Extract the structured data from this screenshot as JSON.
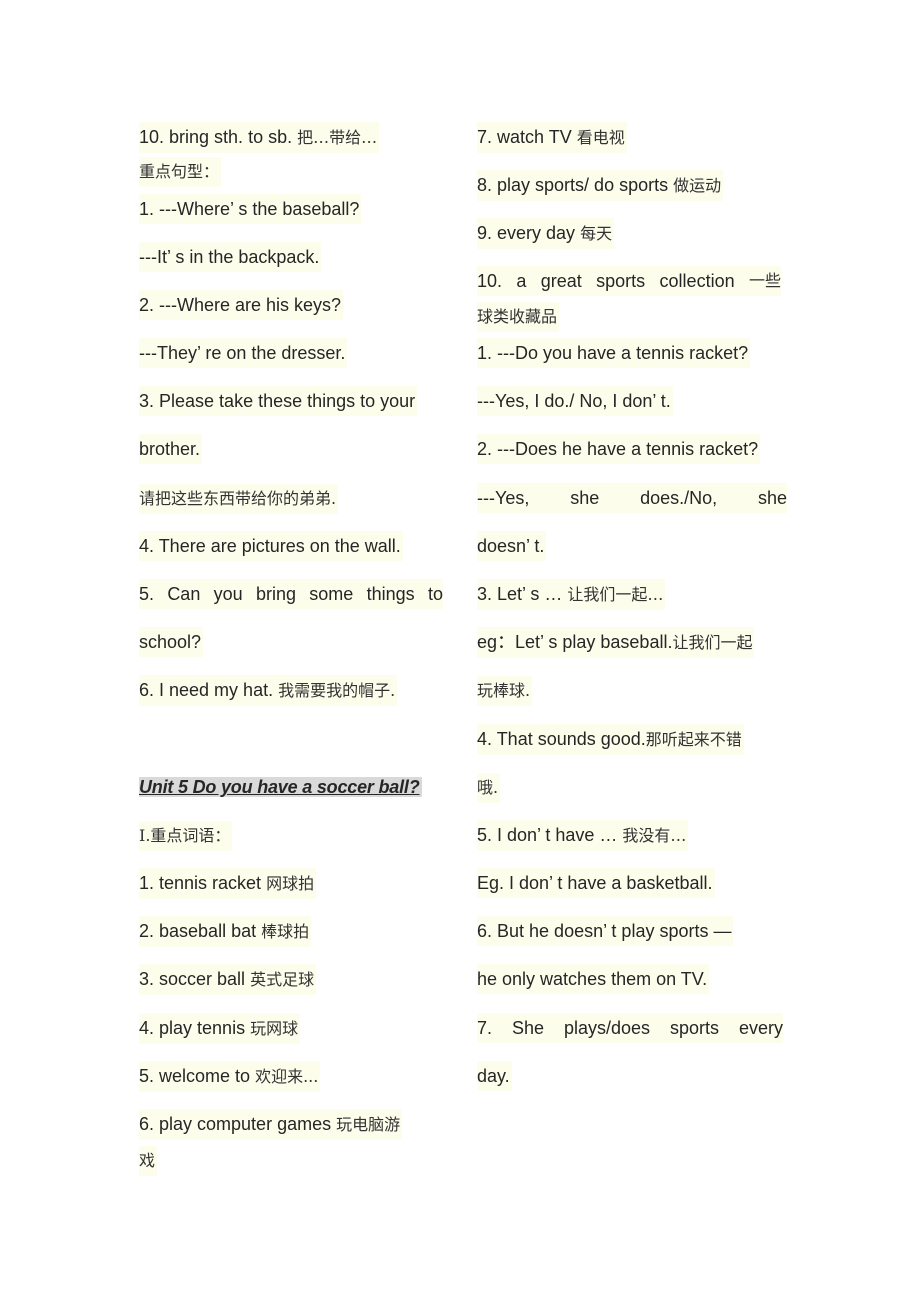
{
  "left_column": {
    "lines": [
      {
        "en": "10. bring sth. to sb. ",
        "zh": "把…带给…"
      },
      {
        "en": "",
        "zh": "重点句型："
      },
      {
        "en": "1. ---Where’ s the baseball?",
        "zh": ""
      },
      {
        "en": "---It’ s in the backpack.",
        "zh": ""
      },
      {
        "en": "2. ---Where are his keys?",
        "zh": ""
      },
      {
        "en": "---They’ re on the dresser.",
        "zh": ""
      },
      {
        "en": "3. Please take these things to your",
        "zh": ""
      },
      {
        "en": "brother.",
        "zh": ""
      },
      {
        "en": "",
        "zh": "请把这些东西带给你的弟弟."
      },
      {
        "en": "4. There are pictures on the wall.",
        "zh": ""
      },
      {
        "en": "5. Can you bring some things to",
        "zh": ""
      },
      {
        "en": "school?",
        "zh": ""
      },
      {
        "en": "6. I need my hat. ",
        "zh": "我需要我的帽子."
      }
    ],
    "unit_title": "Unit 5 Do you have a soccer ball?",
    "section_heading": "Ⅰ.重点词语：",
    "vocab": [
      {
        "en": "1. tennis racket ",
        "zh": "网球拍"
      },
      {
        "en": "2. baseball bat ",
        "zh": "棒球拍"
      },
      {
        "en": "3. soccer ball ",
        "zh": "英式足球"
      },
      {
        "en": "4. play tennis ",
        "zh": "玩网球"
      },
      {
        "en": "5. welcome to ",
        "zh": "欢迎来..."
      },
      {
        "en": "6. play computer games ",
        "zh": "玩电脑游"
      },
      {
        "en": "",
        "zh": "戏"
      }
    ]
  },
  "right_column": {
    "lines": [
      {
        "en": "7. watch TV ",
        "zh": "看电视"
      },
      {
        "en": "8. play sports/ do sports ",
        "zh": "做运动"
      },
      {
        "en": "9. every day ",
        "zh": "每天"
      },
      {
        "en": "10. a great sports collection ",
        "zh": "一些"
      },
      {
        "en": "",
        "zh": "球类收藏品"
      },
      {
        "en": "1. ---Do you have a tennis racket?",
        "zh": ""
      },
      {
        "en": "---Yes, I do./ No, I don’ t.",
        "zh": ""
      },
      {
        "en": "2. ---Does he have a tennis racket?",
        "zh": ""
      },
      {
        "en": "---Yes, she does./No, she",
        "zh": ""
      },
      {
        "en": "doesn’ t.",
        "zh": ""
      },
      {
        "en": "3. Let’ s … ",
        "zh": "让我们一起…"
      },
      {
        "en": "eg：Let’ s play baseball.",
        "zh": "让我们一起"
      },
      {
        "en": "",
        "zh": "玩棒球."
      },
      {
        "en": "4. That sounds good.",
        "zh": "那听起来不错"
      },
      {
        "en": "",
        "zh": "哦."
      },
      {
        "en": "5. I don’ t have … ",
        "zh": "我没有…"
      },
      {
        "en": "Eg. I don’ t have a basketball.",
        "zh": ""
      },
      {
        "en": "6. But he doesn’ t play sports —",
        "zh": ""
      },
      {
        "en": "he only watches them on TV.",
        "zh": ""
      },
      {
        "en": "7. She plays/does sports every",
        "zh": ""
      },
      {
        "en": "day.",
        "zh": ""
      }
    ]
  },
  "justified_words": {
    "yes_she": [
      "---Yes,",
      "she",
      "does./No,",
      "she"
    ],
    "she_plays": [
      "7.",
      "She",
      "plays/does",
      "sports",
      "every"
    ],
    "can_you": [
      "5.",
      "Can",
      "you",
      "bring",
      "some",
      "things",
      "to"
    ],
    "great_sports": [
      "10.",
      "a",
      "great",
      "sports",
      "collection",
      "一些"
    ]
  }
}
